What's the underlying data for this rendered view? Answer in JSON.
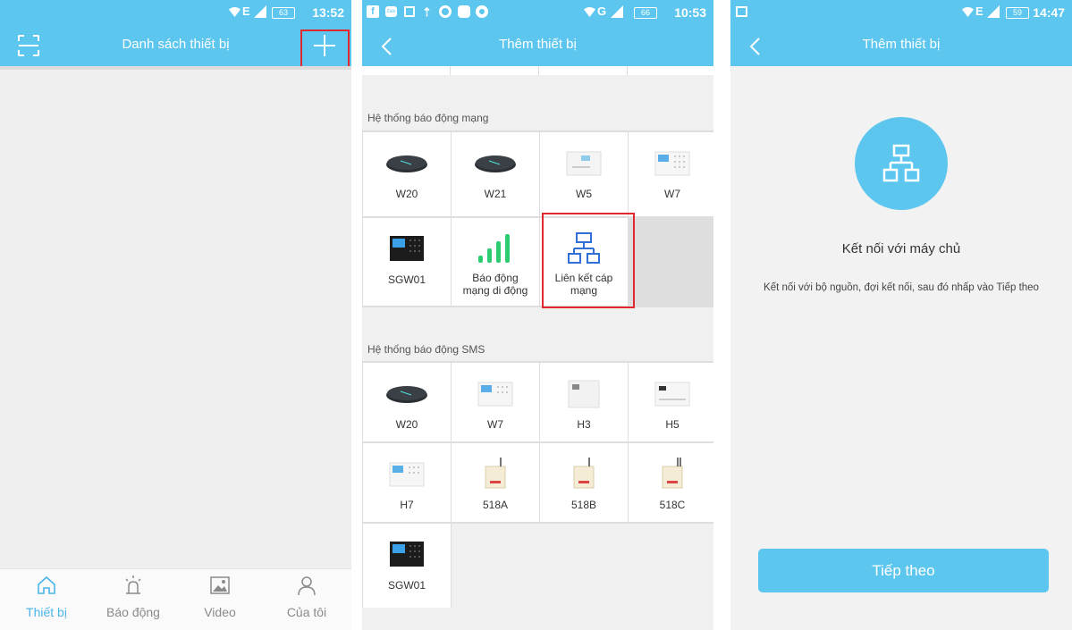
{
  "screen1": {
    "time": "13:52",
    "battery": "63",
    "network": "E",
    "title": "Danh sách thiết bị",
    "tabs": [
      {
        "label": "Thiết bị",
        "icon": "home-icon",
        "active": true
      },
      {
        "label": "Báo động",
        "icon": "alarm-light-icon",
        "active": false
      },
      {
        "label": "Video",
        "icon": "image-icon",
        "active": false
      },
      {
        "label": "Của tôi",
        "icon": "user-icon",
        "active": false
      }
    ]
  },
  "screen2": {
    "time": "10:53",
    "battery": "66",
    "network": "G",
    "title": "Thêm thiết bị",
    "notification_icons": [
      "facebook-icon",
      "zalo-icon",
      "gallery-icon",
      "upload-icon",
      "chrome-icon",
      "app-icon",
      "eye-icon"
    ],
    "zalo_label": "Zalo",
    "section_network": "Hệ thống báo động mạng",
    "network_devices": [
      {
        "label": "W20",
        "icon": "hub-dark-icon"
      },
      {
        "label": "W21",
        "icon": "hub-dark-icon"
      },
      {
        "label": "W5",
        "icon": "panel-white-icon"
      },
      {
        "label": "W7",
        "icon": "keypad-white-icon"
      },
      {
        "label": "SGW01",
        "icon": "panel-black-icon"
      },
      {
        "label": "Báo động mạng di động",
        "icon": "signal-bars-icon"
      },
      {
        "label": "Liên kết cáp mạng",
        "icon": "network-topology-icon"
      }
    ],
    "section_sms": "Hệ thống báo động SMS",
    "sms_devices": [
      {
        "label": "W20",
        "icon": "hub-dark-icon"
      },
      {
        "label": "W7",
        "icon": "keypad-white-icon"
      },
      {
        "label": "H3",
        "icon": "panel-white-icon"
      },
      {
        "label": "H5",
        "icon": "panel-white-icon"
      },
      {
        "label": "H7",
        "icon": "keypad-white-icon"
      },
      {
        "label": "518A",
        "icon": "box-antenna-icon"
      },
      {
        "label": "518B",
        "icon": "box-antenna-icon"
      },
      {
        "label": "518C",
        "icon": "box-antenna-icon"
      },
      {
        "label": "SGW01",
        "icon": "panel-black-icon"
      }
    ]
  },
  "screen3": {
    "time": "14:47",
    "battery": "59",
    "network": "E",
    "title": "Thêm thiết bị",
    "heading": "Kết nối với máy chủ",
    "description": "Kết nối với bộ nguồn, đợi kết nối, sau đó nhấp vào Tiếp theo",
    "next_button": "Tiếp theo"
  },
  "colors": {
    "accent": "#5cc6ef",
    "highlight": "#e0282e",
    "active_tab": "#4ab5e6",
    "signal_green": "#2ecc71",
    "topology_blue": "#2f6fd6"
  }
}
